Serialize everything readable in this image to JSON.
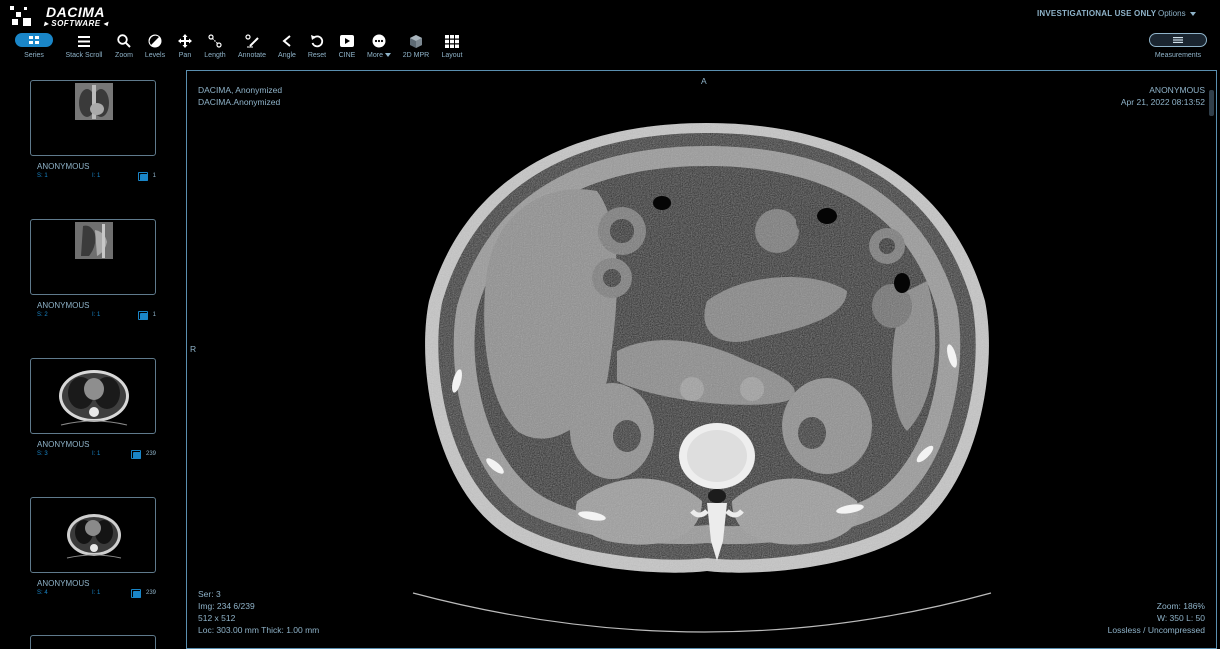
{
  "app": {
    "logo_line1": "DACIMA",
    "logo_line2": "SOFTWARE",
    "investigational": "INVESTIGATIONAL USE ONLY",
    "options_label": "Options"
  },
  "toolbar": {
    "series": "Series",
    "stack_scroll": "Stack Scroll",
    "zoom": "Zoom",
    "levels": "Levels",
    "pan": "Pan",
    "length": "Length",
    "annotate": "Annotate",
    "angle": "Angle",
    "reset": "Reset",
    "cine": "CINE",
    "more": "More",
    "mpr": "2D MPR",
    "layout": "Layout",
    "measurements": "Measurements"
  },
  "sidebar": {
    "items": [
      {
        "name": "ANONYMOUS",
        "s_label": "S: 1",
        "i_label": "I: 1",
        "count": "1"
      },
      {
        "name": "ANONYMOUS",
        "s_label": "S: 2",
        "i_label": "I: 1",
        "count": "1"
      },
      {
        "name": "ANONYMOUS",
        "s_label": "S: 3",
        "i_label": "I: 1",
        "count": "239"
      },
      {
        "name": "ANONYMOUS",
        "s_label": "S: 4",
        "i_label": "I: 1",
        "count": "239"
      }
    ]
  },
  "viewport": {
    "top_left_1": "DACIMA, Anonymized",
    "top_left_2": "DACIMA.Anonymized",
    "top_right_1": "ANONYMOUS",
    "top_right_2": "Apr 21, 2022 08:13:52",
    "orient_top": "A",
    "orient_left": "R",
    "bottom_left_1": "Ser: 3",
    "bottom_left_2": "Img: 234 6/239",
    "bottom_left_3": "512 x 512",
    "bottom_left_4": "Loc: 303.00 mm Thick: 1.00 mm",
    "bottom_right_1": "Zoom: 186%",
    "bottom_right_2": "W: 350 L: 50",
    "bottom_right_3": "Lossless / Uncompressed"
  },
  "colors": {
    "accent": "#1a86c8",
    "text": "#8fb3c9",
    "viewport_border": "#5a8fb0",
    "background": "#000000"
  }
}
